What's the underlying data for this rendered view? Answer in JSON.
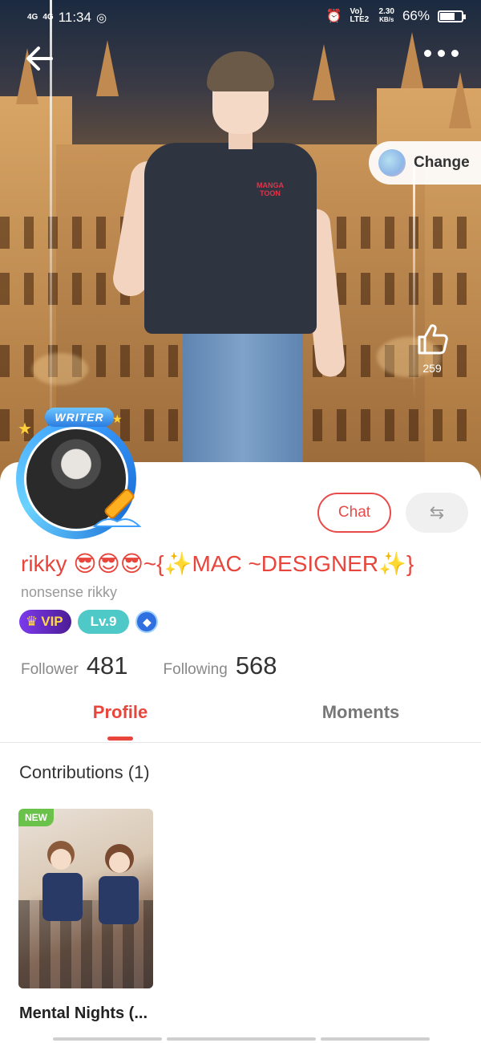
{
  "status_bar": {
    "network_left": "4G",
    "network_left2": "4G",
    "time": "11:34",
    "volte": "Vo) LTE2",
    "speed": "2.30",
    "speed_unit": "KB/s",
    "battery": "66%",
    "battery_level": 0.66
  },
  "hero": {
    "change_label": "Change",
    "like_count": "259",
    "shirt_logo_line1": "MANGA",
    "shirt_logo_line2": "TOON"
  },
  "profile": {
    "badge_writer": "WRITER",
    "name": "rikky 😎😎😎~{✨MAC ~DESIGNER✨}",
    "handle": "nonsense rikky",
    "vip_label": "VIP",
    "level_label": "Lv.9",
    "chat_label": "Chat",
    "switch_icon": "⇆",
    "follower_label": "Follower",
    "follower_count": "481",
    "following_label": "Following",
    "following_count": "568"
  },
  "tabs": [
    {
      "label": "Profile",
      "active": true
    },
    {
      "label": "Moments",
      "active": false
    }
  ],
  "contributions": {
    "title": "Contributions (1)",
    "items": [
      {
        "title": "Mental Nights (...",
        "tag": "NEW"
      }
    ]
  },
  "colors": {
    "accent": "#e8453c",
    "vip": "#4c1d95",
    "level": "#4fc8c8",
    "new_tag": "#6bc24a"
  }
}
